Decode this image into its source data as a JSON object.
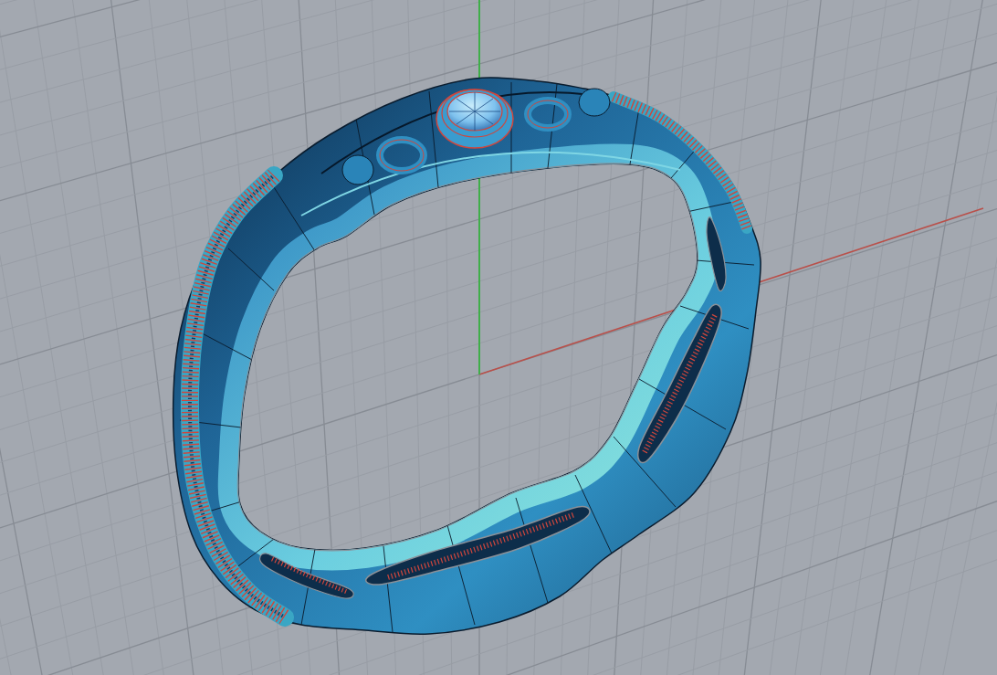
{
  "viewport": {
    "grid": {
      "visible": true
    },
    "axes": [
      {
        "kind": "x",
        "color": "#b9504a"
      },
      {
        "kind": "y",
        "color": "#3fae49"
      }
    ],
    "model": {
      "kind": "ring"
    }
  }
}
